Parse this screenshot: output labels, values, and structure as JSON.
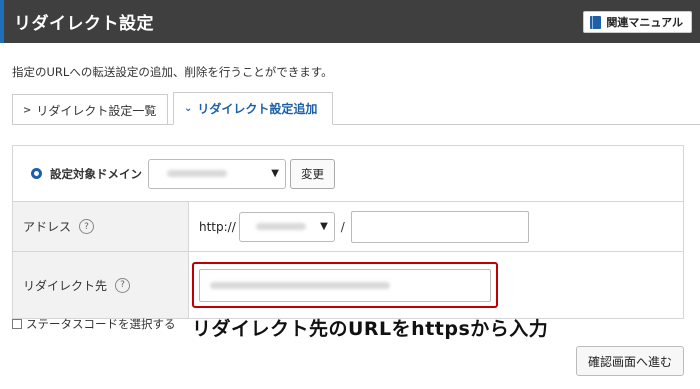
{
  "header": {
    "title": "リダイレクト設定",
    "manual_button": "関連マニュアル",
    "manual_icon": "book-icon"
  },
  "description": "指定のURLへの転送設定の追加、削除を行うことができます。",
  "tabs": [
    {
      "label": "リダイレクト設定一覧",
      "active": false
    },
    {
      "label": "リダイレクト設定追加",
      "active": true
    }
  ],
  "form": {
    "domain_label": "設定対象ドメイン",
    "domain_value_obscured": true,
    "change_button": "変更",
    "address_label": "アドレス",
    "address_prefix": "http://",
    "address_slash": "/",
    "address_path_value": "",
    "redirect_label": "リダイレクト先",
    "redirect_value_obscured": true
  },
  "status_code_checkbox": {
    "label": "ステータスコードを選択する",
    "checked": false
  },
  "annotation": "リダイレクト先のURLをhttpsから入力",
  "confirm_button": "確認画面へ進む",
  "colors": {
    "header_bg": "#3f3f3f",
    "accent": "#1e5fa8",
    "highlight": "#c00000"
  }
}
